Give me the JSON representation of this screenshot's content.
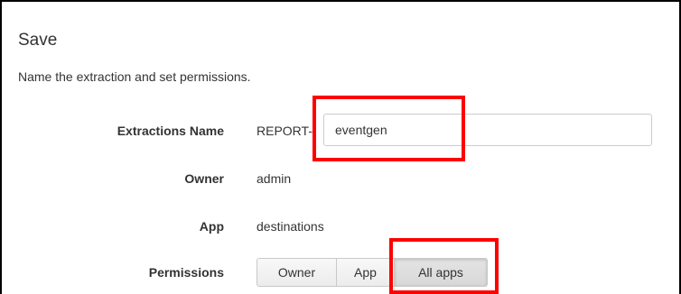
{
  "dialog": {
    "title": "Save",
    "subtitle": "Name the extraction and set permissions."
  },
  "form": {
    "extraction_name": {
      "label": "Extractions Name",
      "prefix": "REPORT-",
      "value": "eventgen"
    },
    "owner": {
      "label": "Owner",
      "value": "admin"
    },
    "app": {
      "label": "App",
      "value": "destinations"
    },
    "permissions": {
      "label": "Permissions",
      "options": [
        "Owner",
        "App",
        "All apps"
      ],
      "selected": "All apps"
    }
  },
  "highlight_color": "#ff0000"
}
